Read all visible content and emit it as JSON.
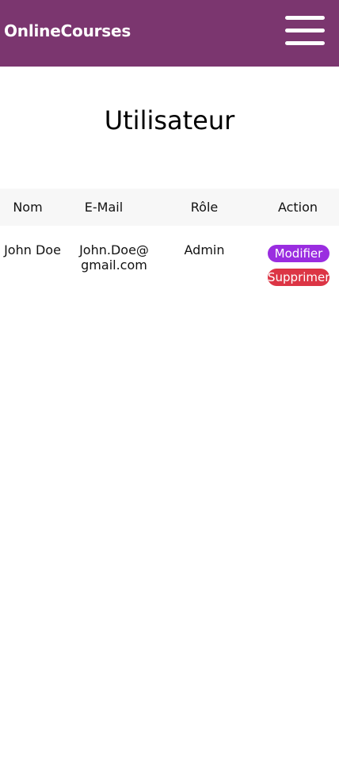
{
  "navbar": {
    "brand": "OnlineCourses",
    "menu_icon": "hamburger-menu-icon"
  },
  "page": {
    "title": "Utilisateur"
  },
  "table": {
    "headers": {
      "name": "Nom",
      "email": "E-Mail",
      "role": "Rôle",
      "action": "Action"
    },
    "rows": [
      {
        "name": "John Doe",
        "email": "John.Doe@ gmail.com",
        "role": "Admin",
        "edit_label": "Modifier",
        "delete_label": "Supprimer"
      }
    ]
  },
  "colors": {
    "navbar": "#7b366f",
    "edit_button": "#9a2de0",
    "delete_button": "#dc3545"
  }
}
